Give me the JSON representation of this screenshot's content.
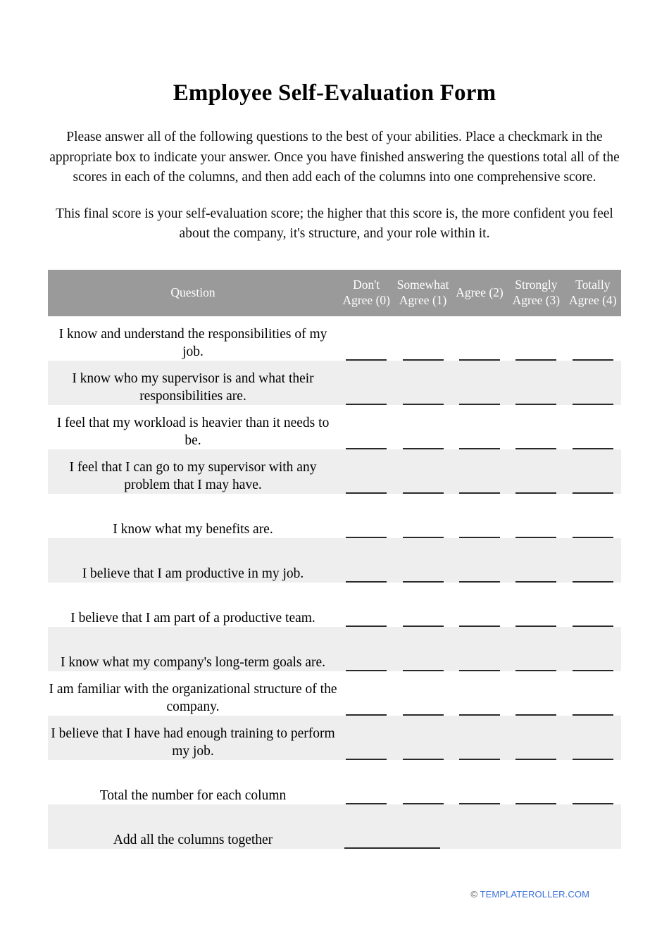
{
  "document": {
    "title": "Employee Self-Evaluation Form",
    "intro_paragraph_1": "Please answer all of the following questions to the best of your abilities. Place a checkmark in the appropriate box to indicate your answer. Once you have finished answering the questions total all of the scores in each of the columns, and then add each of the columns into one comprehensive score.",
    "intro_paragraph_2": "This final score is your self-evaluation score; the higher that this score is, the more confident you feel about the company, it's structure, and your role within it."
  },
  "table": {
    "headers": {
      "question": "Question",
      "options": [
        "Don't Agree (0)",
        "Somewhat Agree (1)",
        "Agree (2)",
        "Strongly Agree (3)",
        "Totally Agree (4)"
      ]
    },
    "rows": [
      {
        "question": "I know and understand the responsibilities of my job."
      },
      {
        "question": "I know who my supervisor is and what their responsibilities are."
      },
      {
        "question": "I feel that my workload is heavier than it needs to be."
      },
      {
        "question": "I feel that I can go to my supervisor with any problem that I may have."
      },
      {
        "question": "I know what my benefits are."
      },
      {
        "question": "I believe that I am productive in my job."
      },
      {
        "question": "I believe that I am part of a productive team."
      },
      {
        "question": "I know what my company's long-term goals are."
      },
      {
        "question": "I am familiar with the organizational structure of the company."
      },
      {
        "question": "I believe that I have had enough training to perform my job."
      }
    ],
    "total_row_label": "Total the number for each column",
    "sum_row_label": "Add all the columns together"
  },
  "footer": {
    "copyright_symbol": "©",
    "site": "TEMPLATEROLLER.COM"
  },
  "colors": {
    "header_background": "#9a9a9a",
    "header_text": "#ffffff",
    "alt_row_background": "#eeeeee",
    "row_background": "#ffffff",
    "rule_color": "#2a2a2a",
    "link_color": "#3a6fd8"
  }
}
